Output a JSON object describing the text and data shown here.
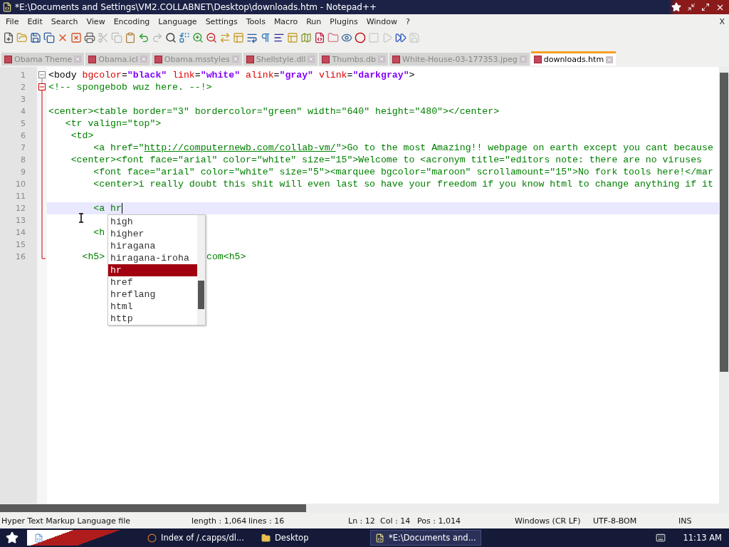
{
  "window": {
    "title": "*E:\\Documents and Settings\\VM2.COLLABNET\\Desktop\\downloads.htm - Notepad++"
  },
  "menu": [
    "File",
    "Edit",
    "Search",
    "View",
    "Encoding",
    "Language",
    "Settings",
    "Tools",
    "Macro",
    "Run",
    "Plugins",
    "Window",
    "?"
  ],
  "menu_close": "X",
  "tabs": [
    {
      "label": "Obama Theme",
      "selected": false
    },
    {
      "label": "Obama.icl",
      "selected": false
    },
    {
      "label": "Obama.msstyles",
      "selected": false
    },
    {
      "label": "Shellstyle.dll",
      "selected": false
    },
    {
      "label": "Thumbs.db",
      "selected": false
    },
    {
      "label": "White-House-03-177353.jpeg",
      "selected": false
    },
    {
      "label": "downloads.htm",
      "selected": true
    }
  ],
  "editor": {
    "lines": [
      {
        "number": "1",
        "current": false,
        "segments": [
          {
            "kind": "tag",
            "text": "<body "
          },
          {
            "kind": "attr",
            "text": "bgcolor"
          },
          {
            "kind": "tag",
            "text": "="
          },
          {
            "kind": "value",
            "text": "\"black\""
          },
          {
            "kind": "attr",
            "text": " link"
          },
          {
            "kind": "tag",
            "text": "="
          },
          {
            "kind": "value",
            "text": "\"white\""
          },
          {
            "kind": "attr",
            "text": " alink"
          },
          {
            "kind": "tag",
            "text": "="
          },
          {
            "kind": "value",
            "text": "\"gray\""
          },
          {
            "kind": "attr",
            "text": " vlink"
          },
          {
            "kind": "tag",
            "text": "="
          },
          {
            "kind": "value",
            "text": "\"darkgray\""
          },
          {
            "kind": "tag",
            "text": ">"
          }
        ]
      },
      {
        "number": "2",
        "current": false,
        "segments": [
          {
            "kind": "comment",
            "text": "<!-- spongebob wuz here. --!>"
          }
        ]
      },
      {
        "number": "3",
        "current": false
      },
      {
        "number": "4",
        "current": false,
        "segments": [
          {
            "kind": "comment",
            "text": "<center><table border=\"3\" bordercolor=\"green\" width=\"640\" height=\"480\"></center>"
          }
        ]
      },
      {
        "number": "5",
        "current": false,
        "segments": [
          {
            "kind": "comment",
            "text": "   <tr valign=\"top\">"
          }
        ]
      },
      {
        "number": "6",
        "current": false,
        "segments": [
          {
            "kind": "comment",
            "text": "    <td>"
          }
        ]
      },
      {
        "number": "7",
        "current": false,
        "segments": [
          {
            "kind": "comment",
            "text": "        <a href=\""
          },
          {
            "kind": "link",
            "text": "http://computernewb.com/collab-vm/"
          },
          {
            "kind": "comment",
            "text": "\">Go to the most Amazing!! webpage on earth except you cant because"
          }
        ]
      },
      {
        "number": "8",
        "current": false,
        "segments": [
          {
            "kind": "comment",
            "text": "    <center><font face=\"arial\" color=\"white\" size=\"15\">Welcome to <acronym title=\"editors note: there are no viruses"
          }
        ]
      },
      {
        "number": "9",
        "current": false,
        "segments": [
          {
            "kind": "comment",
            "text": "        <font face=\"arial\" color=\"white\" size=\"5\"><marquee bgcolor=\"maroon\" scrollamount=\"15\">No fork tools here!</mar"
          }
        ]
      },
      {
        "number": "10",
        "current": false,
        "segments": [
          {
            "kind": "comment",
            "text": "        <center>i really doubt this shit will even last so have your freedom if you know html to change anything if it"
          }
        ]
      },
      {
        "number": "11",
        "current": false
      },
      {
        "number": "12",
        "current": true,
        "segments": [
          {
            "kind": "comment",
            "text": "        <a hr"
          }
        ]
      },
      {
        "number": "13",
        "current": false
      },
      {
        "number": "14",
        "current": false,
        "segments": [
          {
            "kind": "comment",
            "text": "        <h"
          }
        ]
      },
      {
        "number": "15",
        "current": false
      },
      {
        "number": "16",
        "current": false,
        "segments": [
          {
            "kind": "comment",
            "text": "      <h5>"
          }
        ],
        "segments_after_popup": [
          {
            "kind": "comment",
            "text": "com<h5>"
          }
        ]
      }
    ]
  },
  "autocomplete": [
    {
      "label": "high",
      "selected": false
    },
    {
      "label": "higher",
      "selected": false
    },
    {
      "label": "hiragana",
      "selected": false
    },
    {
      "label": "hiragana-iroha",
      "selected": false
    },
    {
      "label": "hr",
      "selected": true
    },
    {
      "label": "href",
      "selected": false
    },
    {
      "label": "hreflang",
      "selected": false
    },
    {
      "label": "html",
      "selected": false
    },
    {
      "label": "http",
      "selected": false
    }
  ],
  "status_bar": {
    "file_type": "Hyper Text Markup Language file",
    "length": "length : 1,064",
    "lines": "lines : 16",
    "ln": "Ln : 12",
    "col": "Col : 14",
    "pos": "Pos : 1,014",
    "eol": "Windows (CR LF)",
    "encoding": "UTF-8-BOM",
    "mode": "INS"
  },
  "taskbar": {
    "items": [
      {
        "label": "Index of /.capps/dl...",
        "selected": false,
        "kind": "web"
      },
      {
        "label": "Desktop",
        "selected": false,
        "kind": "folder"
      },
      {
        "label": "*E:\\Documents and...",
        "selected": true,
        "kind": "notepad"
      }
    ],
    "clock": "11:13 AM"
  }
}
